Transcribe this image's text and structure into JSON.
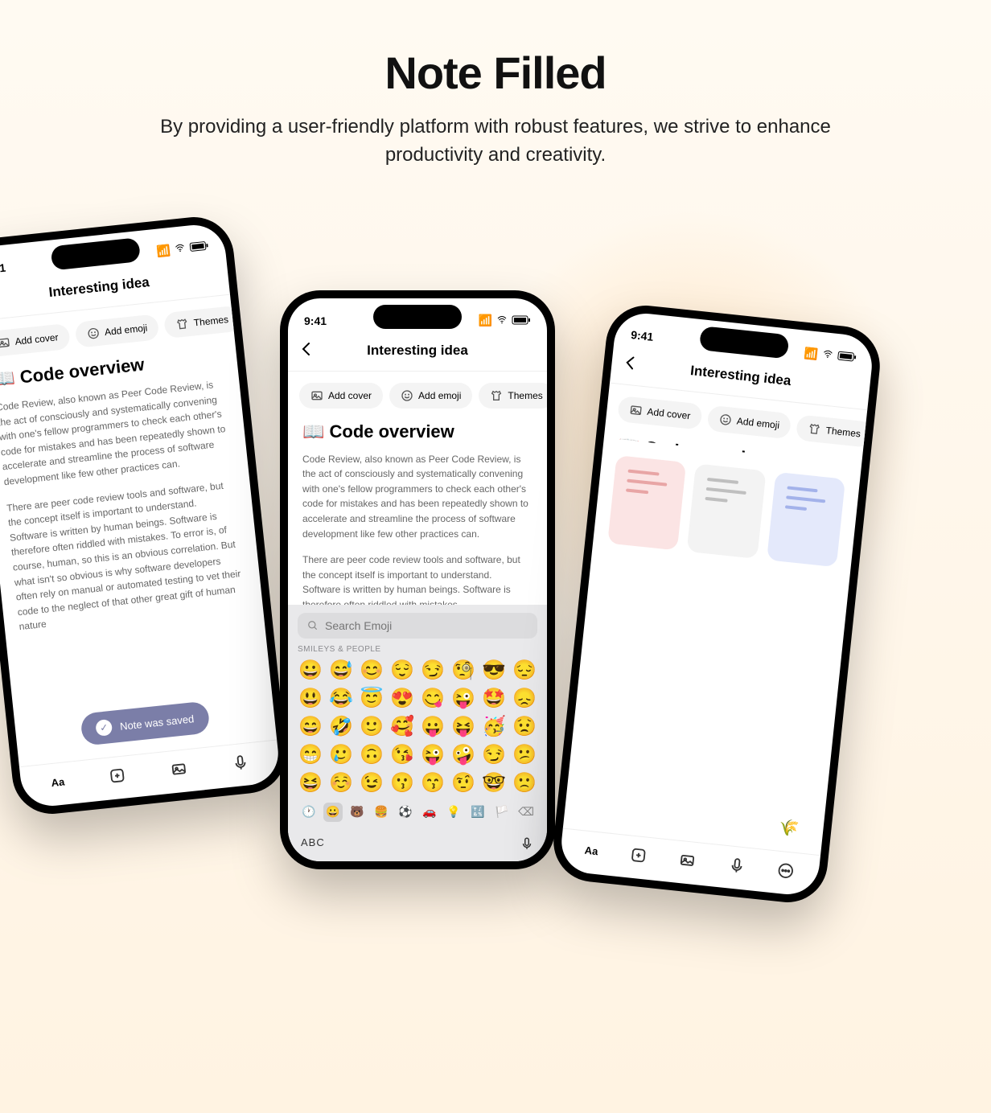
{
  "hero": {
    "title": "Note Filled",
    "subtitle": "By providing a user-friendly platform with robust features, we strive to enhance productivity and creativity."
  },
  "common": {
    "time": "9:41",
    "nav_title": "Interesting idea",
    "pills": {
      "add_cover": "Add cover",
      "add_emoji": "Add emoji",
      "themes": "Themes"
    },
    "note_title": "📖 Code overview",
    "para1": "Code Review, also known as Peer Code Review, is the act of consciously and systematically convening with one's fellow programmers to check each other's code for mistakes and has been repeatedly shown to accelerate and streamline the process of software development like few other practices can.",
    "para2_long": "There are peer code review tools and software, but the concept itself is important to understand. Software is written by human beings.  Software is therefore often riddled with mistakes. To error is, of course, human, so this is an obvious correlation. But what isn't so obvious is why software developers often rely on manual or automated testing to vet their code to the neglect of that other great gift of human nature",
    "para2_short": "There are peer code review tools and software, but the concept itself is important to understand. Software is written by human beings.  Software is therefore often riddled with mistakes."
  },
  "phone1": {
    "toast": "Note was saved",
    "bottom": {
      "text_style": "Aa"
    }
  },
  "phone2": {
    "search_placeholder": "Search Emoji",
    "category_label": "SMILEYS & PEOPLE",
    "emojis": [
      "😀",
      "😅",
      "😊",
      "😌",
      "😏",
      "🧐",
      "😎",
      "😔",
      "😃",
      "😂",
      "😇",
      "😍",
      "😋",
      "😜",
      "🤩",
      "😞",
      "😄",
      "🤣",
      "🙂",
      "🥰",
      "😛",
      "😝",
      "🥳",
      "😟",
      "😁",
      "🥲",
      "🙃",
      "😘",
      "😜",
      "🤪",
      "😏",
      "😕",
      "😆",
      "☺️",
      "😉",
      "😗",
      "😙",
      "🤨",
      "🤓",
      "🙁"
    ],
    "kb_abc": "ABC"
  },
  "phone3": {
    "bottom": {
      "text_style": "Aa"
    }
  }
}
